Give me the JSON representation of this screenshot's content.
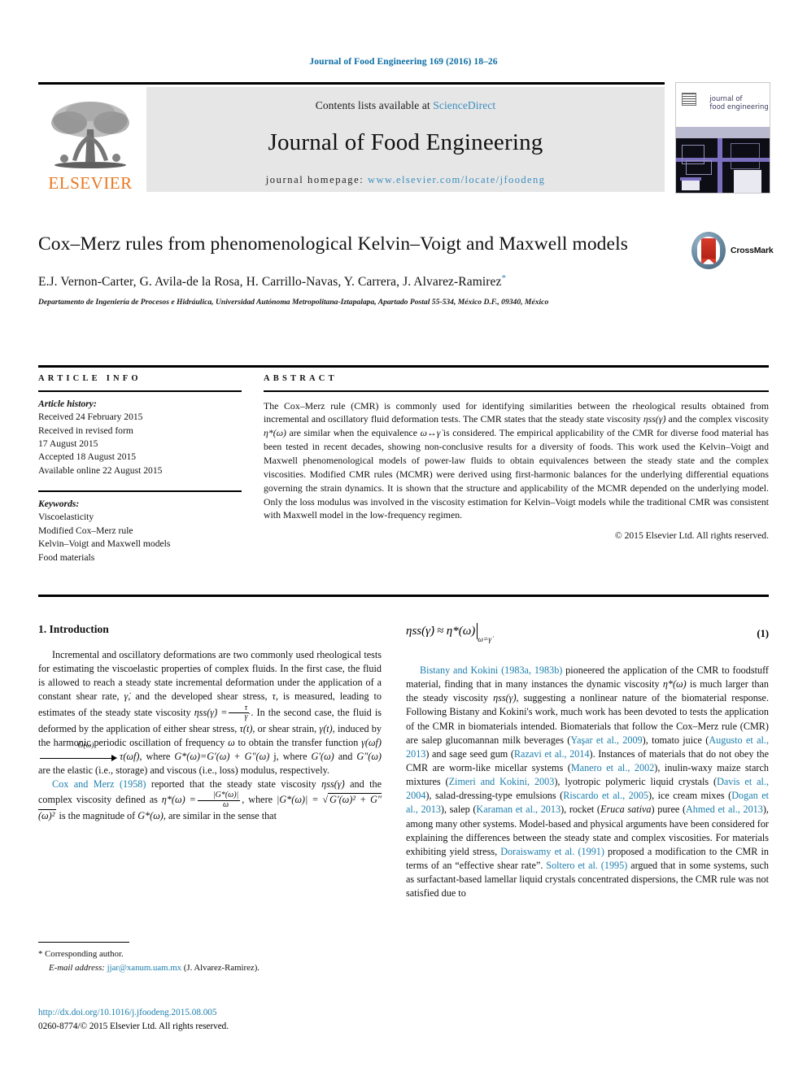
{
  "running_head": "Journal of Food Engineering 169 (2016) 18–26",
  "masthead": {
    "contents_prefix": "Contents lists available at ",
    "sciencedirect": "ScienceDirect",
    "journal_name": "Journal of Food Engineering",
    "homepage_prefix": "journal homepage: ",
    "homepage_url": "www.elsevier.com/locate/jfoodeng",
    "publisher": "ELSEVIER",
    "cover_title_line1": "journal of",
    "cover_title_line2": "food engineering",
    "link_color": "#3b8dbd"
  },
  "article": {
    "title": "Cox–Merz rules from phenomenological Kelvin–Voigt and Maxwell models",
    "authors": "E.J. Vernon-Carter, G. Avila-de la Rosa, H. Carrillo-Navas, Y. Carrera, J. Alvarez-Ramirez",
    "corresponding_marker": "*",
    "affiliation": "Departamento de Ingeniería de Procesos e Hidráulica, Universidad Autónoma Metropolitana-Iztapalapa, Apartado Postal 55-534, México D.F., 09340, México",
    "crossmark_label": "CrossMark"
  },
  "article_info": {
    "heading": "ARTICLE INFO",
    "history_label": "Article history:",
    "history": [
      "Received 24 February 2015",
      "Received in revised form",
      "17 August 2015",
      "Accepted 18 August 2015",
      "Available online 22 August 2015"
    ],
    "keywords_label": "Keywords:",
    "keywords": [
      "Viscoelasticity",
      "Modified Cox–Merz rule",
      "Kelvin–Voigt and Maxwell models",
      "Food materials"
    ]
  },
  "abstract": {
    "heading": "ABSTRACT",
    "part1": "The Cox–Merz rule (CMR) is commonly used for identifying similarities between the rheological results obtained from incremental and oscillatory fluid deformation tests. The CMR states that the steady state viscosity ",
    "eta_ss": "ηss",
    "gamma_dot_paren": "(γ̇)",
    "part2": " and the complex viscosity ",
    "eta_star": "η*",
    "omega_paren": "(ω)",
    "part3": " are similar when the equivalence ",
    "equiv": "ω↔γ̇",
    "part4": " is considered. The empirical applicability of the CMR for diverse food material has been tested in recent decades, showing non-conclusive results for a diversity of foods. This work used the Kelvin–Voigt and Maxwell phenomenological models of power-law fluids to obtain equivalences between the steady state and the complex viscosities. Modified CMR rules (MCMR) were derived using first-harmonic balances for the underlying differential equations governing the strain dynamics. It is shown that the structure and applicability of the MCMR depended on the underlying model. Only the loss modulus was involved in the viscosity estimation for Kelvin–Voigt models while the traditional CMR was consistent with Maxwell model in the low-frequency regimen.",
    "copyright": "© 2015 Elsevier Ltd. All rights reserved."
  },
  "introduction": {
    "section_title": "1. Introduction",
    "p1_a": "Incremental and oscillatory deformations are two commonly used rheological tests for estimating the viscoelastic properties of complex fluids. In the first case, the fluid is allowed to reach a steady state incremental deformation under the application of a constant shear rate, ",
    "p1_gammadot": "γ̇",
    "p1_b": ", and the developed shear stress, ",
    "p1_tau": "τ",
    "p1_c": ", is measured, leading to estimates of the steady state viscosity ",
    "p1_eqa": "ηss(γ̇) =",
    "p1_frac_num": "τ",
    "p1_frac_den": "γ̇",
    "p1_d": ". In the second case, the fluid is deformed by the application of either shear stress, ",
    "p1_taut": "τ(t)",
    "p1_e": ", or shear strain, ",
    "p1_gammat": "γ(t)",
    "p1_f": ", induced by the harmonic periodic oscillation of frequency ",
    "p1_omega": "ω",
    "p1_g": " to obtain the transfer function ",
    "p1_gwf": "γ(ωf)",
    "p1_arrow_label": "G(ω)",
    "p1_twf": "τ(ωf)",
    "p1_h": ", where ",
    "p1_gstar": "G*(ω)=G′(ω) + G″(ω)",
    "p1_i": " j, where ",
    "p1_gp": "G′(ω)",
    "p1_j": " and ",
    "p1_gpp": "G″(ω)",
    "p1_k": " are the elastic (i.e., storage) and viscous (i.e., loss) modulus, respectively.",
    "p2_ref": "Cox and Merz (1958)",
    "p2_a": " reported that the steady state viscosity ",
    "p2_etass": "ηss(γ̇)",
    "p2_b": " and the complex viscosity defined as ",
    "p2_etastar": "η*(ω) =",
    "p2_frac_num": "|G*(ω)|",
    "p2_frac_den": "ω",
    "p2_c": ", where ",
    "p2_mag_lhs": "|G*(ω)| =",
    "p2_sqrt": "G′(ω)² + G″(ω)²",
    "p2_d": " is the magnitude of ",
    "p2_gstar": "G*(ω)",
    "p2_e": ", are similar in the sense that"
  },
  "equation1": {
    "lhs": "ηss",
    "lhs_arg": "(γ̇)",
    "approx": "≈",
    "rhs": "η*(ω)",
    "condition": "ω=γ̇",
    "number": "(1)"
  },
  "right_column": {
    "r1_ref": "Bistany and Kokini (1983a, 1983b)",
    "r1_a": " pioneered the application of the CMR to foodstuff material, finding that in many instances the dynamic viscosity ",
    "r1_etastar": "η*(ω)",
    "r1_b": " is much larger than the steady viscosity ",
    "r1_etass": "ηss(γ̇)",
    "r1_c": ", suggesting a nonlinear nature of the biomaterial response. Following Bistany and Kokini's work, much work has been devoted to tests the application of the CMR in biomaterials intended. Biomaterials that follow the Cox–Merz rule (CMR) are salep glucomannan milk beverages (",
    "ref_yasar": "Yaşar et al., 2009",
    "r1_d": "), tomato juice (",
    "ref_augusto": "Augusto et al., 2013",
    "r1_e": ") and sage seed gum (",
    "ref_razavi": "Razavi et al., 2014",
    "r1_f": "). Instances of materials that do not obey the CMR are worm-like micellar systems (",
    "ref_manero": "Manero et al., 2002",
    "r1_g": "), inulin-waxy maize starch mixtures (",
    "ref_zimeri": "Zimeri and Kokini, 2003",
    "r1_h": "), lyotropic polymeric liquid crystals (",
    "ref_davis": "Davis et al., 2004",
    "r1_i": "), salad-dressing-type emulsions (",
    "ref_riscardo": "Riscardo et al., 2005",
    "r1_j": "), ice cream mixes (",
    "ref_dogan": "Dogan et al., 2013",
    "r1_k": "), salep (",
    "ref_karaman": "Karaman et al., 2013",
    "r1_l": "), rocket (",
    "eruca": "Eruca sativa",
    "r1_m": ") puree (",
    "ref_ahmed": "Ahmed et al., 2013",
    "r1_n": "), among many other systems. Model-based and physical arguments have been considered for explaining the differences between the steady state and complex viscosities. For materials exhibiting yield stress, ",
    "ref_doraiswamy": "Doraiswamy et al. (1991)",
    "r1_o": " proposed a modification to the CMR in terms of an “effective shear rate”. ",
    "ref_soltero": "Soltero et al. (1995)",
    "r1_p": " argued that in some systems, such as surfactant-based lamellar liquid crystals concentrated dispersions, the CMR rule was not satisfied due to"
  },
  "footnote": {
    "marker": "*",
    "corresponding": "Corresponding author.",
    "email_label": "E-mail address:",
    "email": "jjar@xanum.uam.mx",
    "email_owner": "(J. Alvarez-Ramirez).",
    "doi": "http://dx.doi.org/10.1016/j.jfoodeng.2015.08.005",
    "issn_line": "0260-8774/© 2015 Elsevier Ltd. All rights reserved."
  }
}
